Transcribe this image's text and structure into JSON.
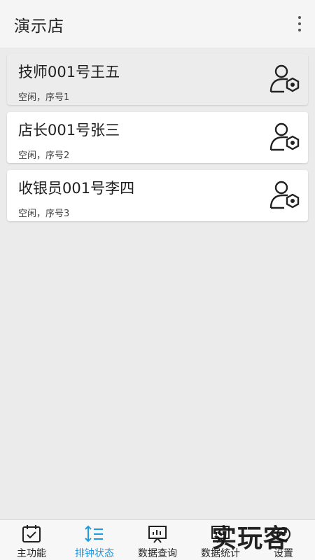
{
  "header": {
    "title": "演示店",
    "menu_icon": "more-vert-icon"
  },
  "staff": [
    {
      "name": "技师001号王五",
      "status": "空闲，序号1",
      "icon": "user-gear-icon",
      "selected": true
    },
    {
      "name": "店长001号张三",
      "status": "空闲，序号2",
      "icon": "user-gear-icon",
      "selected": false
    },
    {
      "name": "收银员001号李四",
      "status": "空闲，序号3",
      "icon": "user-gear-icon",
      "selected": false
    }
  ],
  "bottom_nav": {
    "active_index": 1,
    "active_color": "#1e9be0",
    "items": [
      {
        "label": "主功能",
        "icon": "calendar-check-icon"
      },
      {
        "label": "排钟状态",
        "icon": "sort-list-icon"
      },
      {
        "label": "数据查询",
        "icon": "chart-board-icon"
      },
      {
        "label": "数据统计",
        "icon": "chart-board-icon"
      },
      {
        "label": "设置",
        "icon": "settings-icon"
      }
    ]
  },
  "watermark": {
    "text": "实玩客"
  }
}
